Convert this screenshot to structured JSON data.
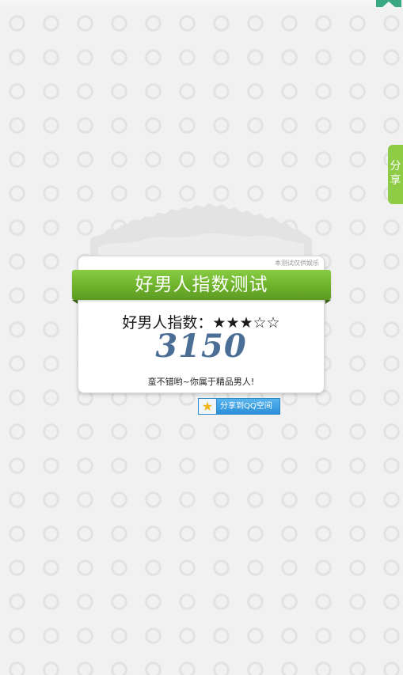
{
  "sidebar": {
    "share_tab": [
      "分",
      "享"
    ]
  },
  "card": {
    "disclaimer": "本测试仅供娱乐",
    "title": "好男人指数测试",
    "index_label": "好男人指数：",
    "stars": "★★★☆☆",
    "rating": {
      "filled": 3,
      "total": 5
    },
    "score": "3150",
    "message": "蛮不错哟~你属于精品男人!"
  },
  "qq_share": {
    "icon": "star-icon",
    "label": "分享到QQ空间"
  },
  "colors": {
    "background": "#f1f1f1",
    "ribbon_green": "#6eb22b",
    "share_tab_green": "#8fcc46",
    "score_blue": "#4a6e95",
    "bookmark_teal": "#3aa983",
    "qq_blue": "#2b8fd8"
  }
}
